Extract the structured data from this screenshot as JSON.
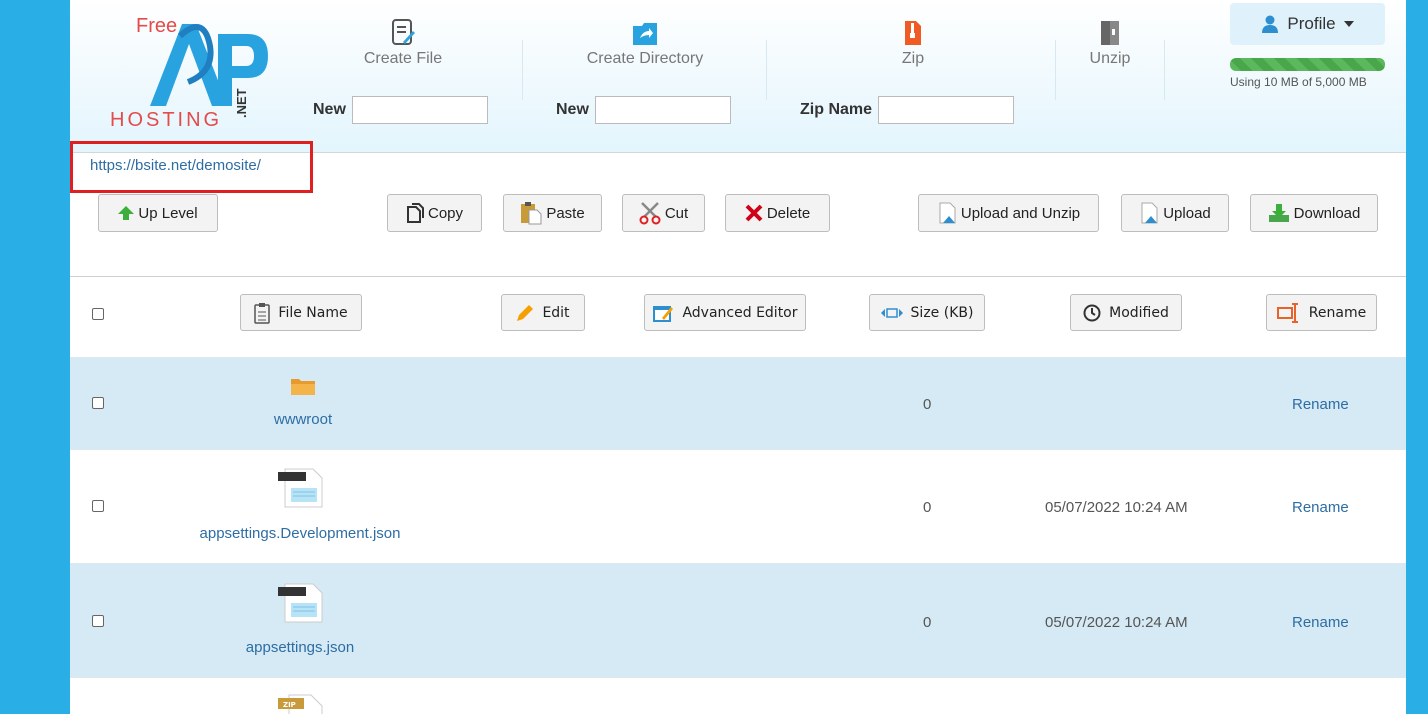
{
  "brand": {
    "logo_free": "Free",
    "logo_hosting": "HOSTING",
    "logo_net": ".NET"
  },
  "toolbar": {
    "create_file": "Create File",
    "create_directory": "Create Directory",
    "zip": "Zip",
    "unzip": "Unzip",
    "new_file_label": "New",
    "new_dir_label": "New",
    "zip_name_label": "Zip Name",
    "new_file_value": "",
    "new_dir_value": "",
    "zip_name_value": ""
  },
  "profile": {
    "label": "Profile",
    "quota_text": "Using 10 MB of 5,000 MB",
    "quota_used_fraction": 1.0
  },
  "path": {
    "url": "https://bsite.net/demosite/"
  },
  "actions": {
    "up_level": "Up Level",
    "copy": "Copy",
    "paste": "Paste",
    "cut": "Cut",
    "delete": "Delete",
    "upload_unzip": "Upload and Unzip",
    "upload": "Upload",
    "download": "Download"
  },
  "columns": {
    "file_name": "File Name",
    "edit": "Edit",
    "advanced_editor": "Advanced Editor",
    "size": "Size (KB)",
    "modified": "Modified",
    "rename": "Rename"
  },
  "files": [
    {
      "name": "wwwroot",
      "type": "folder",
      "size": "0",
      "modified": "",
      "action": "Rename"
    },
    {
      "name": "appsettings.Development.json",
      "type": "file",
      "size": "0",
      "modified": "05/07/2022 10:24 AM",
      "action": "Rename"
    },
    {
      "name": "appsettings.json",
      "type": "file",
      "size": "0",
      "modified": "05/07/2022 10:24 AM",
      "action": "Rename"
    },
    {
      "name": "",
      "type": "zip",
      "size": "",
      "modified": "",
      "action": ""
    }
  ],
  "colors": {
    "background": "#29aee5",
    "link": "#2e6da4",
    "row_alt": "#d5eaf5",
    "highlight": "#e02020"
  }
}
